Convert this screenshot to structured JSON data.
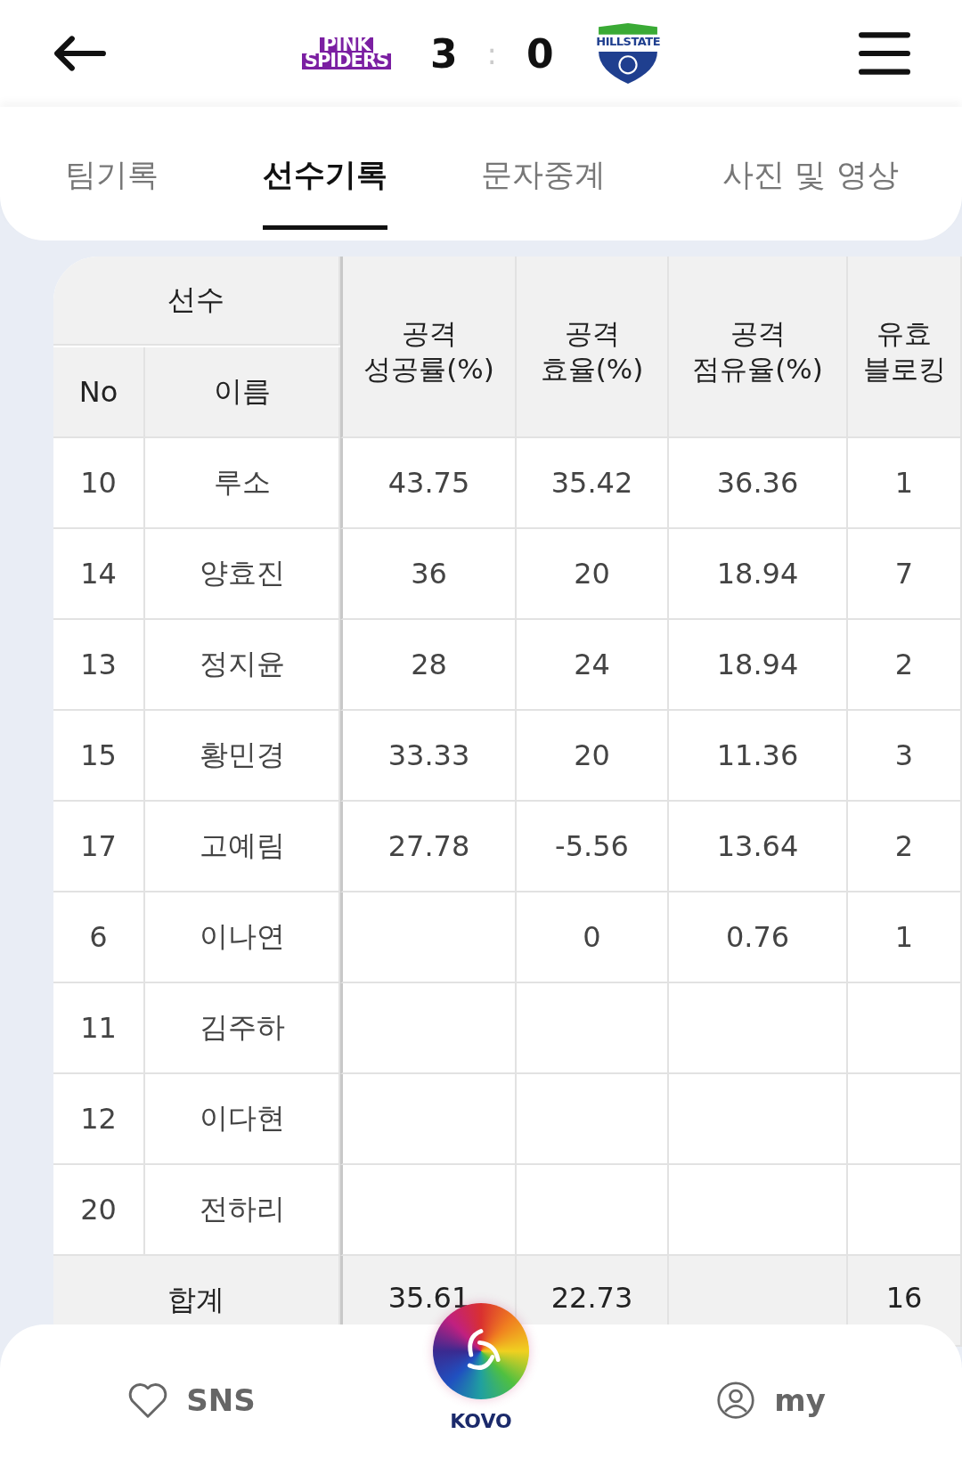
{
  "header": {
    "home_team": {
      "logo_lines": [
        "PINK",
        "SPIDERS"
      ]
    },
    "home_score": "3",
    "separator": ":",
    "away_score": "0",
    "away_team": {
      "logo_text": "HILLSTATE"
    }
  },
  "tabs": [
    {
      "label": "팀기록",
      "selected": false
    },
    {
      "label": "선수기록",
      "selected": true
    },
    {
      "label": "문자중계",
      "selected": false
    },
    {
      "label": "사진 및 영상",
      "selected": false
    }
  ],
  "table": {
    "group_header": "선수",
    "no_header": "No",
    "name_header": "이름",
    "columns": [
      {
        "lines": [
          "공격",
          "성공률(%)"
        ]
      },
      {
        "lines": [
          "공격",
          "효율(%)"
        ]
      },
      {
        "lines": [
          "공격",
          "점유율(%)"
        ]
      },
      {
        "lines": [
          "유효",
          "블로킹"
        ]
      }
    ],
    "rows": [
      {
        "no": "10",
        "name": "루소",
        "cells": [
          "43.75",
          "35.42",
          "36.36",
          "1"
        ]
      },
      {
        "no": "14",
        "name": "양효진",
        "cells": [
          "36",
          "20",
          "18.94",
          "7"
        ]
      },
      {
        "no": "13",
        "name": "정지윤",
        "cells": [
          "28",
          "24",
          "18.94",
          "2"
        ]
      },
      {
        "no": "15",
        "name": "황민경",
        "cells": [
          "33.33",
          "20",
          "11.36",
          "3"
        ]
      },
      {
        "no": "17",
        "name": "고예림",
        "cells": [
          "27.78",
          "-5.56",
          "13.64",
          "2"
        ]
      },
      {
        "no": "6",
        "name": "이나연",
        "cells": [
          null,
          "0",
          "0.76",
          "1"
        ]
      },
      {
        "no": "11",
        "name": "김주하",
        "cells": [
          null,
          null,
          null,
          null
        ]
      },
      {
        "no": "12",
        "name": "이다현",
        "cells": [
          null,
          null,
          null,
          null
        ]
      },
      {
        "no": "20",
        "name": "전하리",
        "cells": [
          null,
          null,
          null,
          null
        ]
      }
    ],
    "total": {
      "label": "합계",
      "cells": [
        "35.61",
        "22.73",
        null,
        "16"
      ]
    }
  },
  "bottom_nav": {
    "sns": "SNS",
    "center": "KOVO",
    "my": "my"
  }
}
